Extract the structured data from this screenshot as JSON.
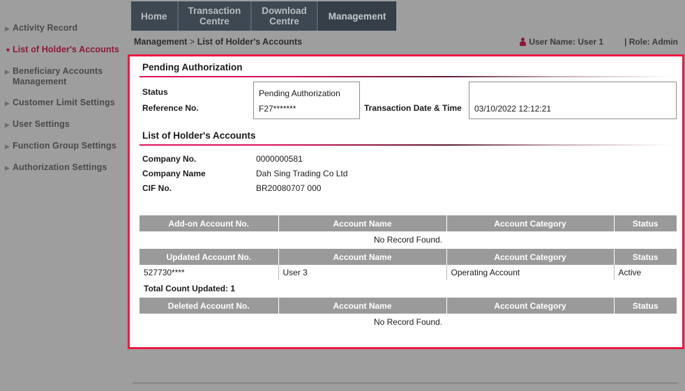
{
  "sidebar": {
    "items": [
      {
        "label": "Activity Record",
        "expanded": false,
        "icon": "triangle-right-icon"
      },
      {
        "label": "List of Holder's Accounts",
        "expanded": true,
        "icon": "triangle-down-icon"
      },
      {
        "label": "Beneficiary Accounts Management",
        "expanded": false,
        "icon": "triangle-right-icon"
      },
      {
        "label": "Customer Limit Settings",
        "expanded": false,
        "icon": "triangle-right-icon"
      },
      {
        "label": "User Settings",
        "expanded": false,
        "icon": "triangle-right-icon"
      },
      {
        "label": "Function Group Settings",
        "expanded": false,
        "icon": "triangle-right-icon"
      },
      {
        "label": "Authorization Settings",
        "expanded": false,
        "icon": "triangle-right-icon"
      }
    ]
  },
  "topnav": {
    "tabs": [
      {
        "label": "Home",
        "active": false
      },
      {
        "label": "Transaction\nCentre",
        "active": false
      },
      {
        "label": "Download\nCentre",
        "active": false
      },
      {
        "label": "Management",
        "active": true
      }
    ]
  },
  "breadcrumb": {
    "root": "Management",
    "separator": ">",
    "current": "List of Holder's Accounts"
  },
  "userbar": {
    "user_icon": "person-icon",
    "user_label": "User Name: User 1",
    "role_label": "| Role: Admin"
  },
  "pending": {
    "section_title": "Pending Authorization",
    "status_label": "Status",
    "status_value": "Pending Authorization",
    "reference_label": "Reference No.",
    "reference_value": "F27*******",
    "txn_datetime_label": "Transaction Date & Time",
    "txn_datetime_value": "03/10/2022 12:12:21"
  },
  "holder": {
    "section_title": "List of Holder's Accounts",
    "company_no_label": "Company No.",
    "company_no_value": "0000000581",
    "company_name_label": "Company Name",
    "company_name_value": "Dah Sing Trading Co Ltd",
    "cif_no_label": "CIF No.",
    "cif_no_value": "BR20080707 000"
  },
  "tables": {
    "no_record_text": "No Record Found.",
    "addon": {
      "headers": [
        "Add-on Account No.",
        "Account Name",
        "Account Category",
        "Status"
      ],
      "rows": [],
      "empty_text": "No Record Found."
    },
    "updated": {
      "headers": [
        "Updated Account No.",
        "Account Name",
        "Account Category",
        "Status"
      ],
      "rows": [
        [
          "527730****",
          "User 3",
          "Operating Account",
          "Active"
        ]
      ],
      "total_text": "Total Count Updated: 1"
    },
    "deleted": {
      "headers": [
        "Deleted Account No.",
        "Account Name",
        "Account Category",
        "Status"
      ],
      "rows": [],
      "empty_text": "No Record Found."
    }
  },
  "colors": {
    "panel_border": "#ed1944",
    "accent_rule": "#e0115f",
    "nav_bg": "#3e4852",
    "nav_active_bg": "#363f49",
    "page_bg": "#9e9e9e",
    "table_header_bg": "#9a9a9a",
    "sidebar_active_text": "#8b1a36"
  }
}
